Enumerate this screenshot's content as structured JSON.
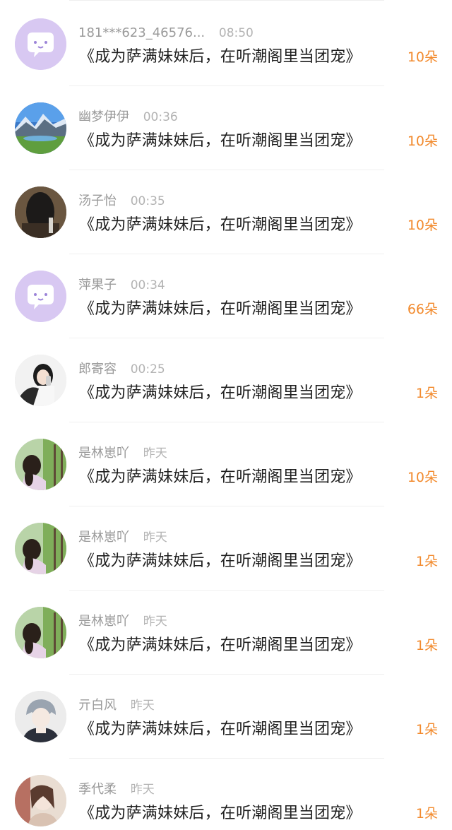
{
  "gift_list": {
    "items": [
      {
        "user": "181***623_46576...",
        "time": "08:50",
        "book": "《成为萨满妹妹后，在听潮阁里当团宠》",
        "gift": "10朵",
        "avatar": "default-chat-bubble-avatar"
      },
      {
        "user": "幽梦伊伊",
        "time": "00:36",
        "book": "《成为萨满妹妹后，在听潮阁里当团宠》",
        "gift": "10朵",
        "avatar": "mountain-lake-avatar"
      },
      {
        "user": "汤子怡",
        "time": "00:35",
        "book": "《成为萨满妹妹后，在听潮阁里当团宠》",
        "gift": "10朵",
        "avatar": "dark-photo-avatar"
      },
      {
        "user": "萍果子",
        "time": "00:34",
        "book": "《成为萨满妹妹后，在听潮阁里当团宠》",
        "gift": "66朵",
        "avatar": "default-chat-bubble-avatar"
      },
      {
        "user": "郎寄容",
        "time": "00:25",
        "book": "《成为萨满妹妹后，在听潮阁里当团宠》",
        "gift": "1朵",
        "avatar": "selfie-girl-avatar"
      },
      {
        "user": "是林崽吖",
        "time": "昨天",
        "book": "《成为萨满妹妹后，在听潮阁里当团宠》",
        "gift": "10朵",
        "avatar": "girl-trees-avatar"
      },
      {
        "user": "是林崽吖",
        "time": "昨天",
        "book": "《成为萨满妹妹后，在听潮阁里当团宠》",
        "gift": "1朵",
        "avatar": "girl-trees-avatar"
      },
      {
        "user": "是林崽吖",
        "time": "昨天",
        "book": "《成为萨满妹妹后，在听潮阁里当团宠》",
        "gift": "1朵",
        "avatar": "girl-trees-avatar"
      },
      {
        "user": "亓白风",
        "time": "昨天",
        "book": "《成为萨满妹妹后，在听潮阁里当团宠》",
        "gift": "1朵",
        "avatar": "anime-character-avatar"
      },
      {
        "user": "季代柔",
        "time": "昨天",
        "book": "《成为萨满妹妹后，在听潮阁里当团宠》",
        "gift": "1朵",
        "avatar": "anime-painting-avatar"
      }
    ]
  },
  "colors": {
    "gift_text": "#f28a2d",
    "default_avatar_bg": "#d8c8f2",
    "username_text": "#9a9a9a",
    "title_text": "#1f1f1f"
  }
}
